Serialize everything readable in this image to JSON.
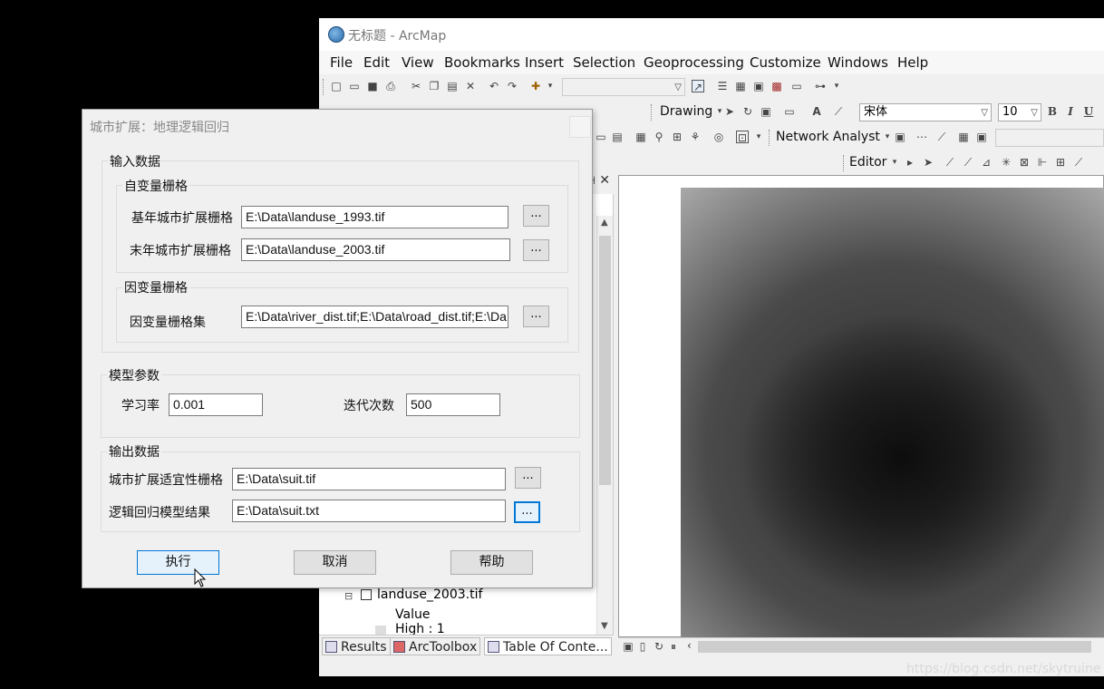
{
  "arcmap": {
    "title": "无标题 - ArcMap",
    "menu": [
      "File",
      "Edit",
      "View",
      "Bookmarks",
      "Insert",
      "Selection",
      "Geoprocessing",
      "Customize",
      "Windows",
      "Help"
    ],
    "toolbar_drawing": "Drawing",
    "font_name": "宋体",
    "font_size": "10",
    "bold": "B",
    "italic": "I",
    "underline": "U",
    "network_analyst": "Network Analyst",
    "editor": "Editor",
    "toc": {
      "layer_name": "landuse_2003.tif",
      "value_label": "Value",
      "high_label": "High : 1"
    },
    "bottom_tabs": [
      "Results",
      "ArcToolbox",
      "Table Of Conte..."
    ]
  },
  "dialog": {
    "title": "城市扩展：地理逻辑回归",
    "input_group": "输入数据",
    "dependent_group": "自变量栅格",
    "base_year_label": "基年城市扩展栅格",
    "base_year_value": "E:\\Data\\landuse_1993.tif",
    "end_year_label": "末年城市扩展栅格",
    "end_year_value": "E:\\Data\\landuse_2003.tif",
    "factor_group": "因变量栅格",
    "factor_label": "因变量栅格集",
    "factor_value": "E:\\Data\\river_dist.tif;E:\\Data\\road_dist.tif;E:\\Da",
    "browse": "...",
    "model_group": "模型参数",
    "learning_rate_label": "学习率",
    "learning_rate_value": "0.001",
    "iterations_label": "迭代次数",
    "iterations_value": "500",
    "output_group": "输出数据",
    "suitability_label": "城市扩展适宜性栅格",
    "suitability_value": "E:\\Data\\suit.tif",
    "model_result_label": "逻辑回归模型结果",
    "model_result_value": "E:\\Data\\suit.txt",
    "run": "执行",
    "cancel": "取消",
    "help": "帮助"
  },
  "watermark": "https://blog.csdn.net/skytruine"
}
